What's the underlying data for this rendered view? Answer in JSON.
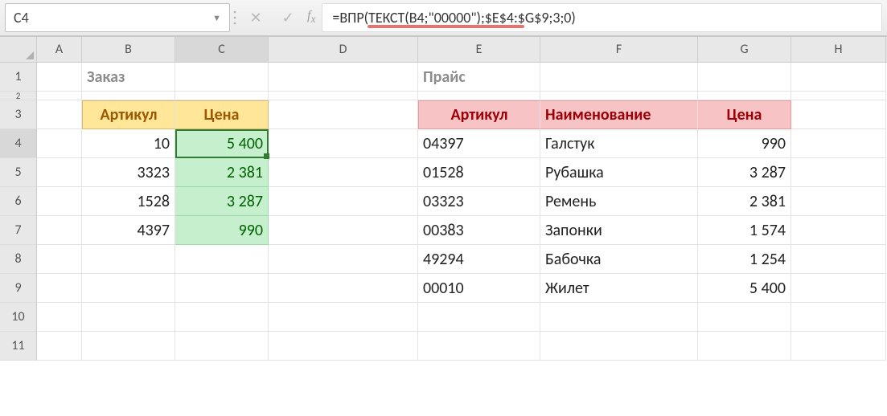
{
  "formula_bar": {
    "cell_ref": "C4",
    "formula": "=ВПР(ТЕКСТ(B4;\"00000\");$E$4:$G$9;3;0)"
  },
  "columns": [
    "A",
    "B",
    "C",
    "D",
    "E",
    "F",
    "G",
    "H"
  ],
  "rows": [
    "1",
    "2",
    "3",
    "4",
    "5",
    "6",
    "7",
    "8",
    "9",
    "10",
    "11"
  ],
  "labels": {
    "order_title": "Заказ",
    "price_title": "Прайс",
    "order_col_sku": "Артикул",
    "order_col_price": "Цена",
    "price_col_sku": "Артикул",
    "price_col_name": "Наименование",
    "price_col_price": "Цена"
  },
  "order": {
    "rows": [
      {
        "sku": "10",
        "price": "5 400"
      },
      {
        "sku": "3323",
        "price": "2 381"
      },
      {
        "sku": "1528",
        "price": "3 287"
      },
      {
        "sku": "4397",
        "price": "990"
      }
    ]
  },
  "pricelist": {
    "rows": [
      {
        "sku": "04397",
        "name": "Галстук",
        "price": "990"
      },
      {
        "sku": "01528",
        "name": "Рубашка",
        "price": "3 287"
      },
      {
        "sku": "03323",
        "name": "Ремень",
        "price": "2 381"
      },
      {
        "sku": "00383",
        "name": "Запонки",
        "price": "1 574"
      },
      {
        "sku": "49294",
        "name": "Бабочка",
        "price": "1 254"
      },
      {
        "sku": "00010",
        "name": "Жилет",
        "price": "5 400"
      }
    ]
  },
  "active_cell": "C4"
}
